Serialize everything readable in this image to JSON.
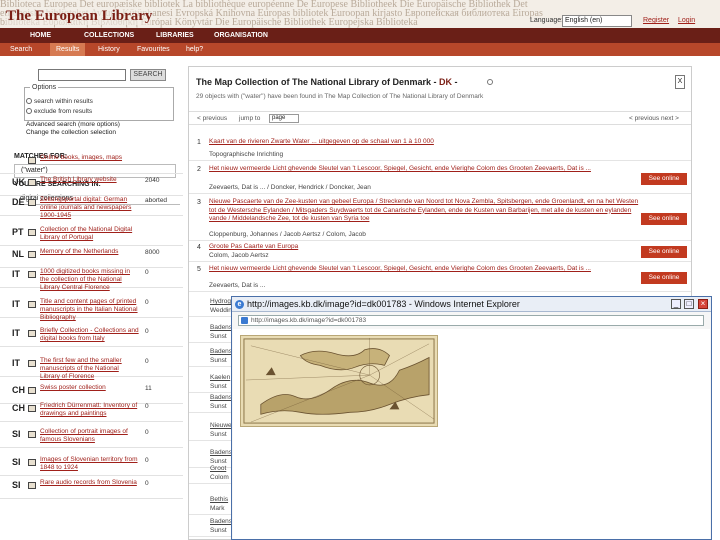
{
  "header": {
    "banner_ghost_text": "Biblioteca Europea Det europæiske bibliotek La bibliothèque européenne De Europese Bibliotheek Die Europäische Bibliothek Det europeiska biblioteket Avrupa Kütüphanesi Evropská Knihovna Europas bibliotek Euroopan kirjasto Европейская библиотека Eiropas bibliotēka Ευρωπαϊκή Βιβλιοθήκη Európai Könyvtár Die Europäische Bibliothek Europejska Biblioteka",
    "logo": "The European Library",
    "language_label": "Language:",
    "language_value": "English (en)",
    "register": "Register",
    "login": "Login"
  },
  "nav": {
    "primary": [
      "HOME",
      "COLLECTIONS",
      "LIBRARIES",
      "ORGANISATION"
    ],
    "secondary": [
      "Search",
      "Results",
      "History",
      "Favourites",
      "help?"
    ]
  },
  "left": {
    "search_button": "SEARCH",
    "options_title": "Options",
    "option_within": "search within results",
    "option_exclude": "exclude from results",
    "advanced": "Advanced search (more options)",
    "change": "Change the collection selection",
    "matches_heading": "MATCHES FOR:",
    "matches_value": "(\"water\")",
    "searching_heading": "YOU ARE SEARCHING IN:",
    "collections_heading": "digital collections",
    "collections": [
      {
        "cc": "",
        "title": "Online books, images, maps",
        "count": ""
      },
      {
        "cc": "UK",
        "title": "The British Library website",
        "count": "2040"
      },
      {
        "cc": "DE",
        "title": "Zeitungsportal digital: German online journals and newspapers 1900-1945",
        "count": "aborted"
      },
      {
        "cc": "PT",
        "title": "Collection of the National Digital Library of Portugal",
        "count": ""
      },
      {
        "cc": "NL",
        "title": "Memory of the Netherlands",
        "count": "8000"
      },
      {
        "cc": "IT",
        "title": "1000 digitized books missing in the collection of the National Library Central Florence",
        "count": "0"
      },
      {
        "cc": "IT",
        "title": "Title and content pages of printed manuscripts in the Italian National Bibliography",
        "count": "0"
      },
      {
        "cc": "IT",
        "title": "Briefly Collection - Collections and digital books from Italy",
        "count": "0"
      },
      {
        "cc": "IT",
        "title": "The first few and the smaller manuscripts of the National Library of Florence",
        "count": "0"
      },
      {
        "cc": "CH",
        "title": "Swiss poster collection",
        "count": "11"
      },
      {
        "cc": "CH",
        "title": "Friedrich Dürrenmatt: Inventory of drawings and paintings",
        "count": "0"
      },
      {
        "cc": "SI",
        "title": "Collection of portrait images of famous Slovenians",
        "count": "0"
      },
      {
        "cc": "SI",
        "title": "Images of Slovenian territory from 1848 to 1924",
        "count": "0"
      },
      {
        "cc": "SI",
        "title": "Rare audio records from Slovenia",
        "count": "0"
      }
    ]
  },
  "main": {
    "title_prefix": "The Map Collection of The National Library of Denmark - ",
    "title_code": "DK",
    "title_suffix": " -",
    "close": "X",
    "found": "29 objects with (\"water\") have been found in The Map Collection of The National Library of Denmark",
    "pager_left": "< previous",
    "pager_jump": "jump to",
    "pager_box": "page",
    "pager_right": "< previous  next >",
    "see_online": "See online",
    "results": [
      {
        "num": "1",
        "title": "Kaart van de rivieren Zwarte Water ... uitgegeven op de schaal van 1 à 10 000",
        "sub": "Topographische Inrichting",
        "see": false
      },
      {
        "num": "2",
        "title": "Het nieuw vermeerde Licht ghevende Sleutel van 't Lescoor, Spiegel, Gesicht, ende Vierighe Colom des Grooten Zeevaerts, Dat is ...",
        "sub": "Zeevaerts, Dat is ... / Doncker, Hendrick / Doncker, Jean",
        "see": true
      },
      {
        "num": "3",
        "title": "Nieuwe Pascaerte van de Zee-kusten van gebeel Europa / Streckende van Noord tot Nova Zembla, Spitsbergen, ende Groenlandt, en na het Westen tot de Westersche Eylanden / Mitsgaders Suydwaerts tot de Canarische Eylanden, ende de Kusten van Barbarijen, met alle de kusten en eylanden vande / Middelandsche Zee, tot de kusten van Syria toe",
        "sub": "Cloppenburg, Johannes / Jacob Aertsz / Colom, Jacob",
        "see": true
      },
      {
        "num": "4",
        "title": "Groote Pas Caarte van Europa",
        "sub": "Colom, Jacob Aertsz",
        "see": true
      },
      {
        "num": "5",
        "title": "Het nieuw vermeerde Licht ghevende Sleutel van 't Lescoor, Spiegel, Gesicht, ende Vierighe Colom des Grooten Zeevaerts, Dat is ...",
        "sub": "Zeevaerts, Dat is ...",
        "see": true
      },
      {
        "num": "6",
        "title": "Hydrographie",
        "sub": "Wedding",
        "see": false
      },
      {
        "num": "7",
        "title": "Badens Grundkarte",
        "sub": "Sunst",
        "see": false
      },
      {
        "num": "8",
        "title": "Badens",
        "sub": "Sunst",
        "see": false
      },
      {
        "num": "9",
        "title": "Kaelen",
        "sub": "Sunst",
        "see": false
      },
      {
        "num": "10",
        "title": "Badens",
        "sub": "Sunst",
        "see": false
      },
      {
        "num": "11",
        "title": "Nieuwe",
        "sub": "Sunst",
        "see": false
      },
      {
        "num": "12",
        "title": "Badens",
        "sub": "Sunst",
        "see": false
      },
      {
        "num": "13",
        "title": "Groot",
        "sub": "Colom",
        "see": false
      },
      {
        "num": "14",
        "title": "Bethis",
        "sub": "Mark",
        "see": false
      },
      {
        "num": "15",
        "title": "Badens",
        "sub": "Sunst",
        "see": false
      }
    ]
  },
  "popup": {
    "title": "http://images.kb.dk/image?id=dk001783 - Windows Internet Explorer",
    "address": "http://images.kb.dk/image?id=dk001783"
  }
}
